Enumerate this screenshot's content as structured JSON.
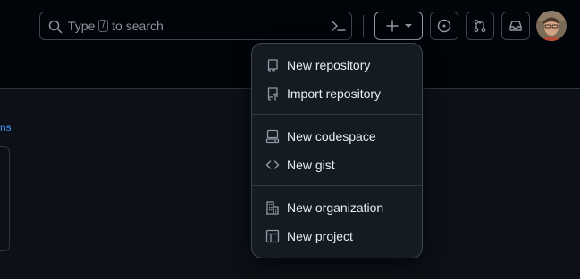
{
  "search": {
    "placeholder_before": "Type",
    "key": "/",
    "placeholder_after": "to search"
  },
  "header_buttons": [
    {
      "name": "create-new",
      "icon": "plus-icon"
    },
    {
      "name": "issues",
      "icon": "issue-opened-icon"
    },
    {
      "name": "pull-requests",
      "icon": "git-pull-request-icon"
    },
    {
      "name": "inbox",
      "icon": "inbox-icon"
    }
  ],
  "left_link": "ns",
  "menu": {
    "items": [
      {
        "label": "New repository",
        "icon": "repo-icon"
      },
      {
        "label": "Import repository",
        "icon": "repo-push-icon"
      },
      {
        "label": "New codespace",
        "icon": "codespaces-icon"
      },
      {
        "label": "New gist",
        "icon": "code-icon"
      },
      {
        "label": "New organization",
        "icon": "organization-icon"
      },
      {
        "label": "New project",
        "icon": "table-icon"
      }
    ]
  },
  "colors": {
    "header_bg": "#010409",
    "page_bg": "#0d1117",
    "menu_bg": "#151b23",
    "border": "#3d444d",
    "link": "#4493f8"
  }
}
